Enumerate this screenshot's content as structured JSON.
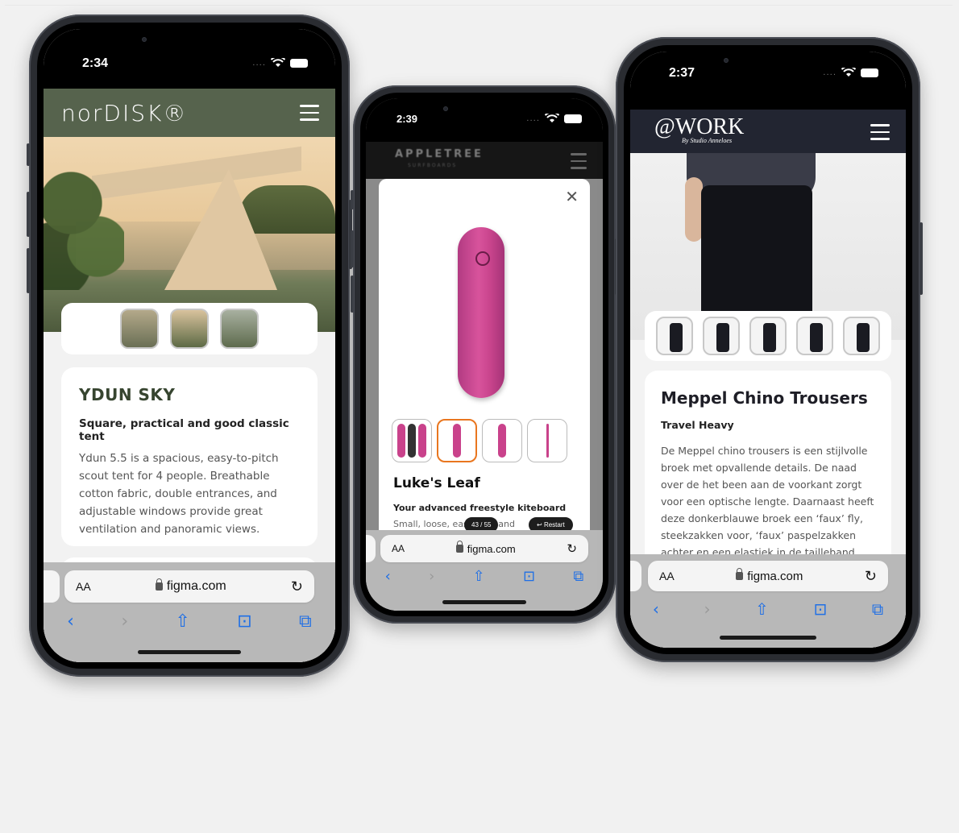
{
  "phone1": {
    "time": "2:34",
    "logo": "norDISK®",
    "product_title": "YDUN SKY",
    "subtitle": "Square, practical and good classic tent",
    "description": "Ydun 5.5 is a spacious, easy-to-pitch scout tent for 4 people. Breathable cotton fabric, double entrances, and adjustable windows provide great ventilation and panoramic views.",
    "url": "figma.com",
    "text_size": "AA"
  },
  "phone2": {
    "time": "2:39",
    "brand": "APPLETREE",
    "brand_sub": "SURFBOARDS",
    "close": "✕",
    "product_title": "Luke's Leaf",
    "subtitle": "Your advanced freestyle kiteboard",
    "description": "Small, loose, easy, kite and",
    "pager": "43 / 55",
    "restart": "Restart",
    "url": "figma.com",
    "text_size": "AA"
  },
  "phone3": {
    "time": "2:37",
    "logo": "@WORK",
    "logo_sub": "By Studio Anneloes",
    "product_title": "Meppel Chino Trousers",
    "subtitle": "Travel Heavy",
    "description": "De Meppel chino trousers is een stijlvolle broek met opvallende details. De naad over de het been aan de voorkant zorgt voor een optische lengte. Daarnaast heeft deze donkerblauwe broek een ‘faux’ fly, steekzakken voor, ‘faux’ paspelzakken achter en een elastiek in de tailleband. Door de riemlussen is het",
    "url": "figma.com",
    "text_size": "AA"
  },
  "colors": {
    "nordisk_green": "#56634d",
    "work_navy": "#222531",
    "accent_orange": "#e9761f",
    "safari_blue": "#1f6fe6"
  }
}
